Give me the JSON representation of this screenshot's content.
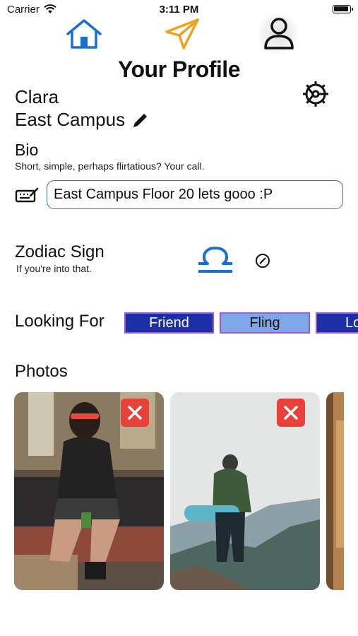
{
  "status_bar": {
    "carrier": "Carrier",
    "time": "3:11 PM"
  },
  "nav": {
    "home_icon": "home-icon",
    "send_icon": "send-icon",
    "profile_icon": "person-icon",
    "colors": {
      "home": "#1a6fd1",
      "send": "#f0a21a",
      "profile": "#111111"
    }
  },
  "header": {
    "title": "Your Profile"
  },
  "profile": {
    "name": "Clara",
    "campus": "East Campus"
  },
  "bio": {
    "label": "Bio",
    "hint": "Short, simple, perhaps flirtatious? Your call.",
    "value": "East Campus Floor 20 lets gooo :P"
  },
  "zodiac": {
    "label": "Zodiac Sign",
    "hint": "If you're into that.",
    "sign_icon": "libra-icon"
  },
  "looking_for": {
    "label": "Looking For",
    "options": [
      {
        "label": "Friend",
        "selected": true
      },
      {
        "label": "Fling",
        "selected": false
      },
      {
        "label": "Lo",
        "selected": true
      }
    ]
  },
  "photos": {
    "label": "Photos",
    "items": [
      {
        "description": "woman-sitting-sunglasses"
      },
      {
        "description": "hiker-on-mountain"
      },
      {
        "description": "partial-photo"
      }
    ]
  },
  "colors": {
    "accent": "#1a6fd1",
    "tag_dark": "#1c2fa6",
    "tag_light": "#7fa8e8",
    "delete": "#e8413a"
  }
}
